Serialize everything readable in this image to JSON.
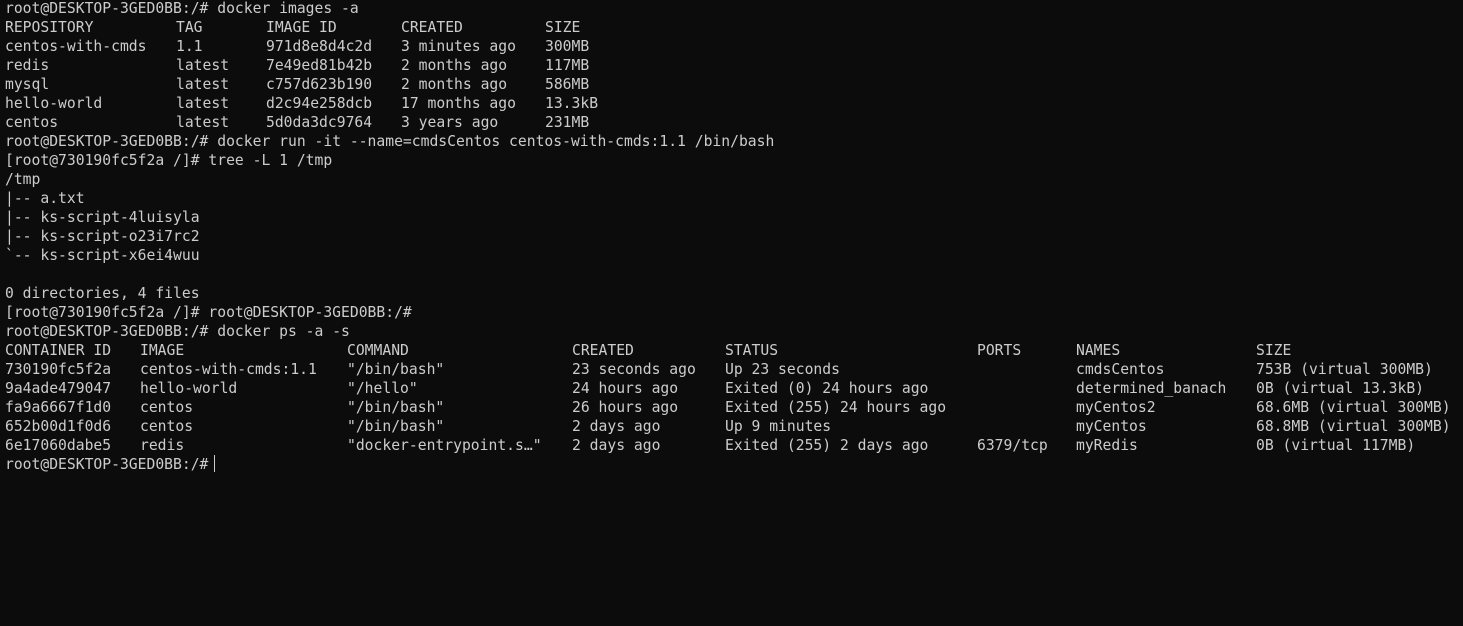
{
  "terminal": {
    "prompt": "root@DESKTOP-3GED0BB:/#",
    "container_prompt": "[root@730190fc5f2a /]#",
    "cmd_images": "docker images -a",
    "images_headers": [
      "REPOSITORY",
      "TAG",
      "IMAGE ID",
      "CREATED",
      "SIZE"
    ],
    "images_rows": [
      [
        "centos-with-cmds",
        "1.1",
        "971d8e8d4c2d",
        "3 minutes ago",
        "300MB"
      ],
      [
        "redis",
        "latest",
        "7e49ed81b42b",
        "2 months ago",
        "117MB"
      ],
      [
        "mysql",
        "latest",
        "c757d623b190",
        "2 months ago",
        "586MB"
      ],
      [
        "hello-world",
        "latest",
        "d2c94e258dcb",
        "17 months ago",
        "13.3kB"
      ],
      [
        "centos",
        "latest",
        "5d0da3dc9764",
        "3 years ago",
        "231MB"
      ]
    ],
    "cmd_run": "docker run -it --name=cmdsCentos centos-with-cmds:1.1 /bin/bash",
    "cmd_tree": "tree -L 1 /tmp",
    "tree_output": [
      "/tmp",
      "|-- a.txt",
      "|-- ks-script-4luisyla",
      "|-- ks-script-o23i7rc2",
      "`-- ks-script-x6ei4wuu",
      "",
      "0 directories, 4 files"
    ],
    "exit_line_tail": "root@DESKTOP-3GED0BB:/#",
    "cmd_ps": "docker ps -a -s",
    "ps_headers": [
      "CONTAINER ID",
      "IMAGE",
      "COMMAND",
      "CREATED",
      "STATUS",
      "PORTS",
      "NAMES",
      "SIZE"
    ],
    "ps_rows": [
      [
        "730190fc5f2a",
        "centos-with-cmds:1.1",
        "\"/bin/bash\"",
        "23 seconds ago",
        "Up 23 seconds",
        "",
        "cmdsCentos",
        "753B (virtual 300MB)"
      ],
      [
        "9a4ade479047",
        "hello-world",
        "\"/hello\"",
        "24 hours ago",
        "Exited (0) 24 hours ago",
        "",
        "determined_banach",
        "0B (virtual 13.3kB)"
      ],
      [
        "fa9a6667f1d0",
        "centos",
        "\"/bin/bash\"",
        "26 hours ago",
        "Exited (255) 24 hours ago",
        "",
        "myCentos2",
        "68.6MB (virtual 300MB)"
      ],
      [
        "652b00d1f0d6",
        "centos",
        "\"/bin/bash\"",
        "2 days ago",
        "Up 9 minutes",
        "",
        "myCentos",
        "68.8MB (virtual 300MB)"
      ],
      [
        "6e17060dabe5",
        "redis",
        "\"docker-entrypoint.s…\"",
        "2 days ago",
        "Exited (255) 2 days ago",
        "6379/tcp",
        "myRedis",
        "0B (virtual 117MB)"
      ]
    ],
    "colors": {
      "background": "#0c0c0c",
      "text": "#cccccc"
    }
  }
}
